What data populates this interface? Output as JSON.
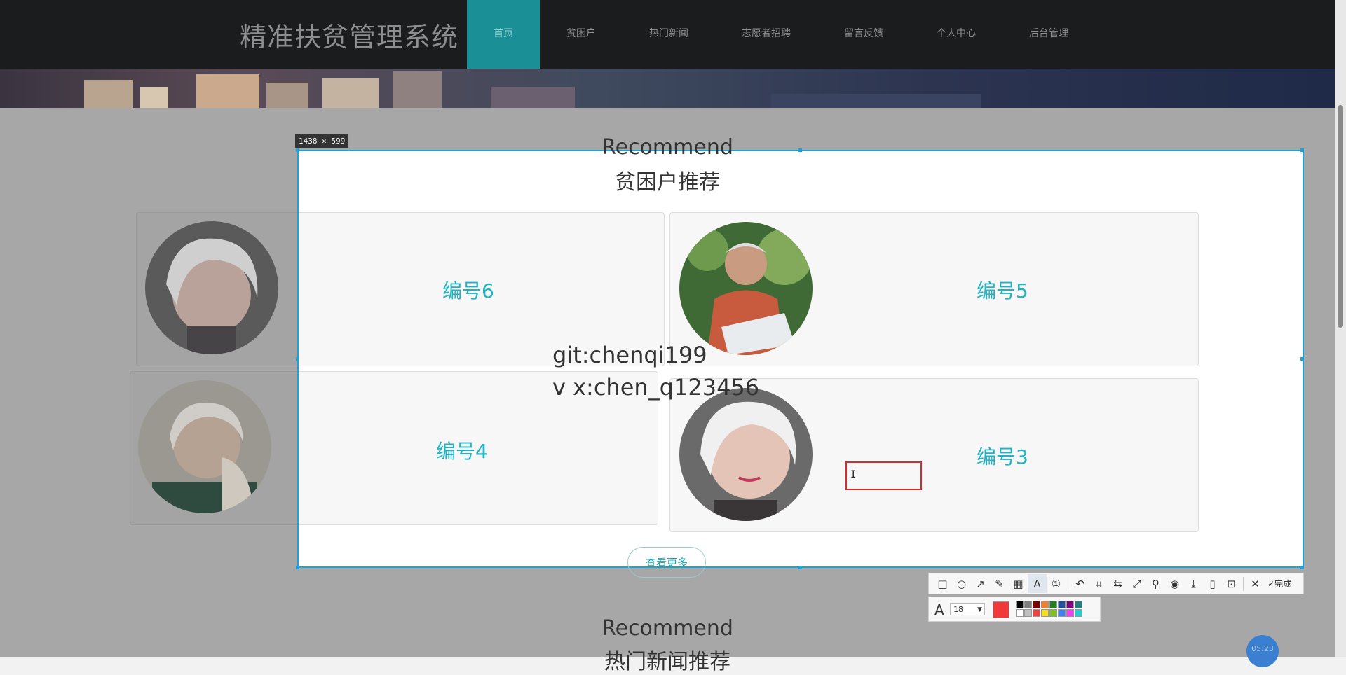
{
  "nav": {
    "brand": "精准扶贫管理系统",
    "items": [
      {
        "label": "首页",
        "active": true
      },
      {
        "label": "贫困户"
      },
      {
        "label": "热门新闻"
      },
      {
        "label": "志愿者招聘"
      },
      {
        "label": "留言反馈"
      },
      {
        "label": "个人中心"
      },
      {
        "label": "后台管理"
      }
    ]
  },
  "section1": {
    "title_en": "Recommend",
    "title_cn": "贫困户推荐",
    "cards": [
      {
        "label": "编号6",
        "avatar": "elderly-woman-portrait"
      },
      {
        "label": "编号5",
        "avatar": "elderly-man-reading-newspaper"
      },
      {
        "label": "编号4",
        "avatar": "smiling-elderly-woman"
      },
      {
        "label": "编号3",
        "avatar": "elderly-woman-portrait"
      }
    ],
    "more_label": "查看更多"
  },
  "section2": {
    "title_en": "Recommend",
    "title_cn": "热门新闻推荐"
  },
  "watermark": {
    "line1": "git:chenqi199",
    "line2": "v x:chen_q123456"
  },
  "capture": {
    "size_label": "1438 × 599",
    "text_tool_cursor": "I",
    "toolbar": {
      "tools": [
        "rectangle-icon",
        "ellipse-icon",
        "arrow-icon",
        "pen-icon",
        "mosaic-icon",
        "text-icon",
        "number-icon",
        "undo-icon",
        "ocr-icon",
        "translate-icon",
        "scroll-capture-icon",
        "pin-icon",
        "record-icon",
        "save-icon",
        "copy-icon",
        "bookmark-icon",
        "close-icon"
      ],
      "done_label": "完成"
    },
    "font_size": "18",
    "current_color": "#f03a3a",
    "palette_row1": [
      "#000000",
      "#808080",
      "#800000",
      "#f08030",
      "#208020",
      "#2050a0",
      "#800080",
      "#208080"
    ],
    "palette_row2": [
      "#ffffff",
      "#c0c0c0",
      "#f04040",
      "#f8e020",
      "#80c020",
      "#4080f0",
      "#f040f0",
      "#20d0d0"
    ]
  },
  "clock": "05:23"
}
